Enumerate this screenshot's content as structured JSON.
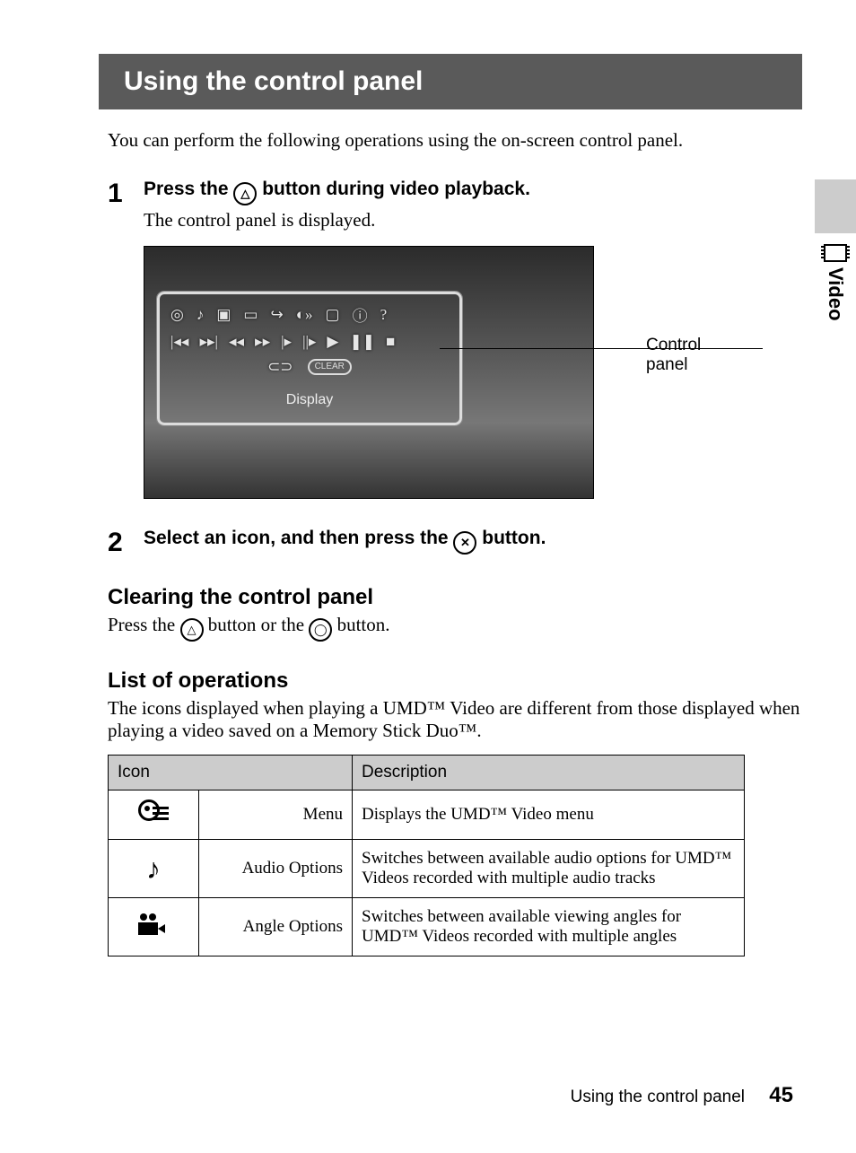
{
  "title": "Using the control panel",
  "intro": "You can perform the following operations using the on-screen control panel.",
  "side_tab": "Video",
  "steps": {
    "s1": {
      "num": "1",
      "head_pre": "Press the ",
      "head_btn": "△",
      "head_post": " button during video playback.",
      "sub": "The control panel is displayed."
    },
    "s2": {
      "num": "2",
      "head_pre": "Select an icon, and then press the ",
      "head_btn": "✕",
      "head_post": " button."
    }
  },
  "screenshot": {
    "callout": "Control panel",
    "clear_label": "CLEAR",
    "display_label": "Display"
  },
  "clearing": {
    "heading": "Clearing the control panel",
    "pre": "Press the ",
    "btn1": "△",
    "mid": " button or the ",
    "btn2": "◯",
    "post": " button."
  },
  "listops": {
    "heading": "List of operations",
    "intro": "The icons displayed when playing a UMD™ Video are different from those displayed when playing a video saved on a Memory Stick Duo™."
  },
  "table": {
    "h_icon": "Icon",
    "h_desc": "Description",
    "rows": [
      {
        "label": "Menu",
        "desc": "Displays the UMD™ Video menu"
      },
      {
        "label": "Audio Options",
        "desc": "Switches between available audio options for UMD™ Videos recorded with multiple audio tracks"
      },
      {
        "label": "Angle Options",
        "desc": "Switches between available viewing angles for UMD™ Videos recorded with multiple angles"
      }
    ]
  },
  "footer": {
    "text": "Using the control panel",
    "page": "45"
  }
}
